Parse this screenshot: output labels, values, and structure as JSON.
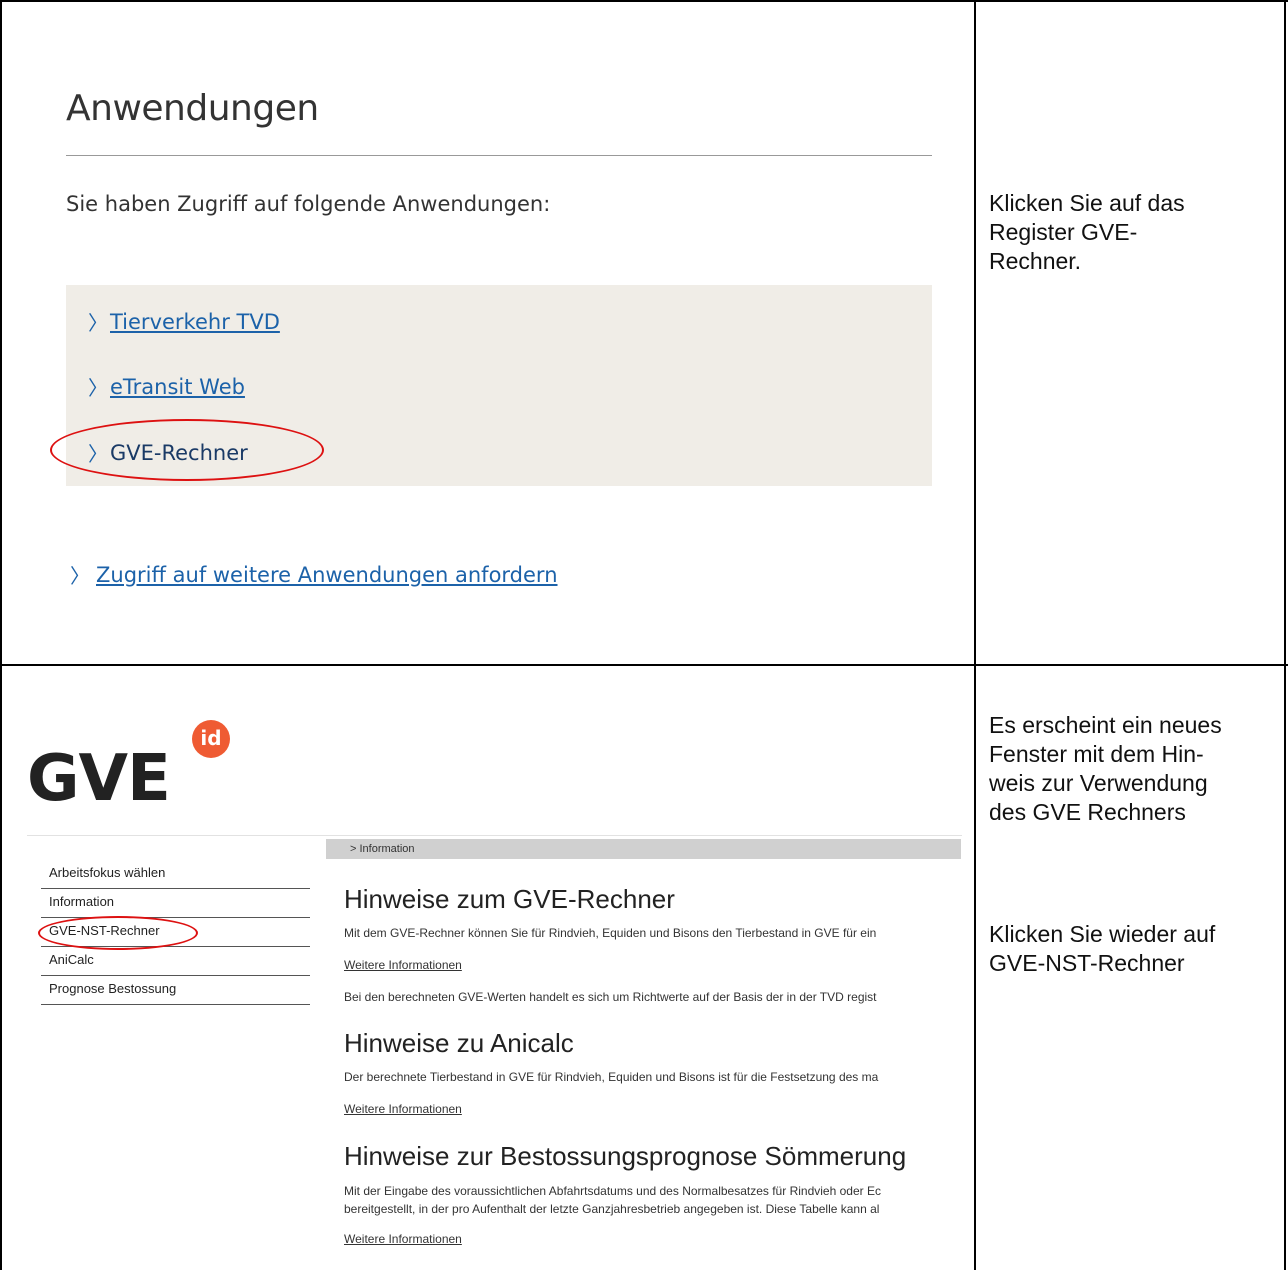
{
  "top": {
    "title": "Anwendungen",
    "subtitle": "Sie haben Zugriff auf folgende Anwendungen:",
    "apps": [
      {
        "label": "Tierverkehr TVD"
      },
      {
        "label": "eTransit Web"
      },
      {
        "label": "GVE-Rechner"
      }
    ],
    "more_link": "Zugriff auf weitere Anwendungen anfordern",
    "instruction": "Klicken Sie auf das Register GVE-Rechner.",
    "instruction_lines": [
      "Klicken Sie auf das",
      "Register GVE-",
      "Rechner."
    ]
  },
  "bottom": {
    "logo_text": "GVE",
    "logo_badge": "id",
    "breadcrumb": "> Information",
    "sidebar": [
      "Arbeitsfokus wählen",
      "Information",
      "GVE-NST-Rechner",
      "AniCalc",
      "Prognose Bestossung"
    ],
    "sections": [
      {
        "heading": "Hinweise zum GVE-Rechner",
        "text1": "Mit dem GVE-Rechner können Sie für Rindvieh, Equiden und Bisons den Tierbestand in GVE für ein",
        "link": "Weitere Informationen",
        "text2": "Bei den berechneten GVE-Werten handelt es sich um Richtwerte auf der Basis der in der TVD regist"
      },
      {
        "heading": "Hinweise zu Anicalc",
        "text1": "Der berechnete Tierbestand in GVE für Rindvieh, Equiden und Bisons ist für die Festsetzung des ma",
        "link": "Weitere Informationen"
      },
      {
        "heading": "Hinweise zur Bestossungsprognose Sömmerung",
        "text1": "Mit der Eingabe des voraussichtlichen Abfahrtsdatums und des Normalbesatzes für Rindvieh oder Ec",
        "text2": "bereitgestellt, in der pro Aufenthalt der letzte Ganzjahresbetrieb angegeben ist. Diese Tabelle kann al",
        "link": "Weitere Informationen"
      }
    ],
    "instruction1_lines": [
      "Es erscheint ein neues",
      "Fenster mit dem Hin-",
      "weis zur Verwendung",
      "des GVE Rechners"
    ],
    "instruction2_lines": [
      "Klicken Sie wieder auf",
      "GVE-NST-Rechner"
    ]
  },
  "colors": {
    "link_blue": "#1c62a9",
    "panel_beige": "#f0ede7",
    "annotation_red": "#d11111",
    "badge_orange": "#ef5b33"
  }
}
